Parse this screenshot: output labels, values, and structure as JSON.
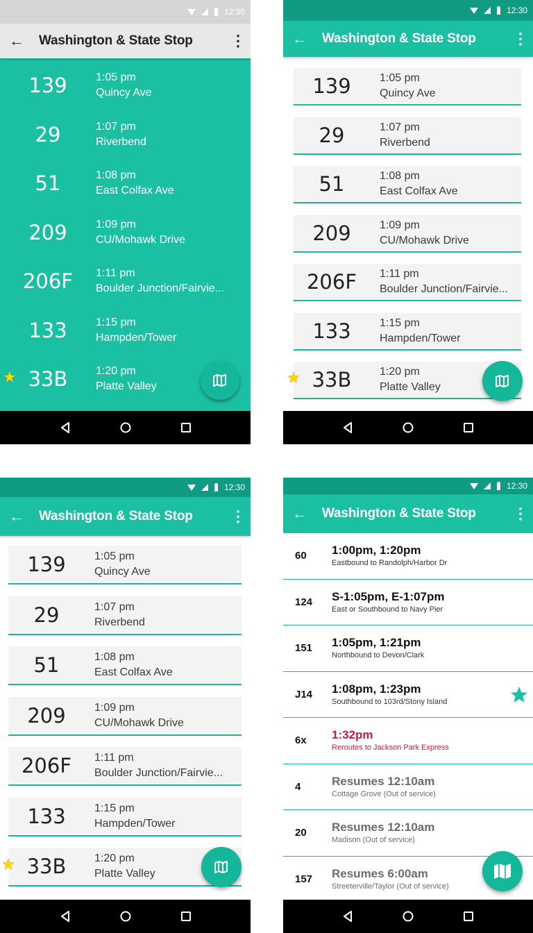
{
  "status": {
    "time": "12:30"
  },
  "stop_title": "Washington & State Stop",
  "card_routes": [
    {
      "route": "139",
      "time": "1:05 pm",
      "destination": "Quincy Ave",
      "favorite": false
    },
    {
      "route": "29",
      "time": "1:07 pm",
      "destination": "Riverbend",
      "favorite": false
    },
    {
      "route": "51",
      "time": "1:08 pm",
      "destination": "East Colfax Ave",
      "favorite": false
    },
    {
      "route": "209",
      "time": "1:09 pm",
      "destination": "CU/Mohawk Drive",
      "favorite": false
    },
    {
      "route": "206F",
      "time": "1:11 pm",
      "destination": "Boulder Junction/Fairvie...",
      "favorite": false
    },
    {
      "route": "133",
      "time": "1:15 pm",
      "destination": "Hampden/Tower",
      "favorite": false
    },
    {
      "route": "33B",
      "time": "1:20 pm",
      "destination": "Platte Valley",
      "favorite": true
    }
  ],
  "list_routes": [
    {
      "route": "60",
      "times": "1:00pm, 1:20pm",
      "detail": "Eastbound to Randolph/Harbor Dr",
      "state": "normal",
      "favorite": false
    },
    {
      "route": "124",
      "times": "S-1:05pm, E-1:07pm",
      "detail": "East or Southbound to Navy Pier",
      "state": "normal",
      "favorite": false
    },
    {
      "route": "151",
      "times": "1:05pm, 1:21pm",
      "detail": "Northbound to Devon/Clark",
      "state": "normal",
      "favorite": false
    },
    {
      "route": "J14",
      "times": "1:08pm, 1:23pm",
      "detail": "Southbound to 103rd/Stony Island",
      "state": "normal",
      "favorite": true
    },
    {
      "route": "6x",
      "times": "1:32pm",
      "detail": "Reroutes to Jackson Park Express",
      "state": "alert",
      "favorite": false
    },
    {
      "route": "4",
      "times": "Resumes 12:10am",
      "detail": "Cottage Grove (Out of service)",
      "state": "muted",
      "favorite": false
    },
    {
      "route": "20",
      "times": "Resumes 12:10am",
      "detail": "Madison (Out of service)",
      "state": "muted",
      "favorite": false
    },
    {
      "route": "157",
      "times": "Resumes 6:00am",
      "detail": "Streeterville/Taylor (Out of service)",
      "state": "muted",
      "favorite": false
    }
  ],
  "colors": {
    "teal": "#1bc0a2",
    "teal_dark": "#0f9c82",
    "appbar_gray": "#e8e8e8",
    "alert_red": "#cc1744",
    "favorite_yellow": "#ffd60a"
  },
  "icons": {
    "back": "arrow-left-icon",
    "more": "more-vert-icon",
    "map": "map-icon",
    "star": "star-icon",
    "wifi": "wifi-icon",
    "signal": "signal-icon",
    "battery": "battery-icon",
    "nav_back": "triangle-back-icon",
    "nav_home": "circle-home-icon",
    "nav_recents": "square-recents-icon"
  }
}
